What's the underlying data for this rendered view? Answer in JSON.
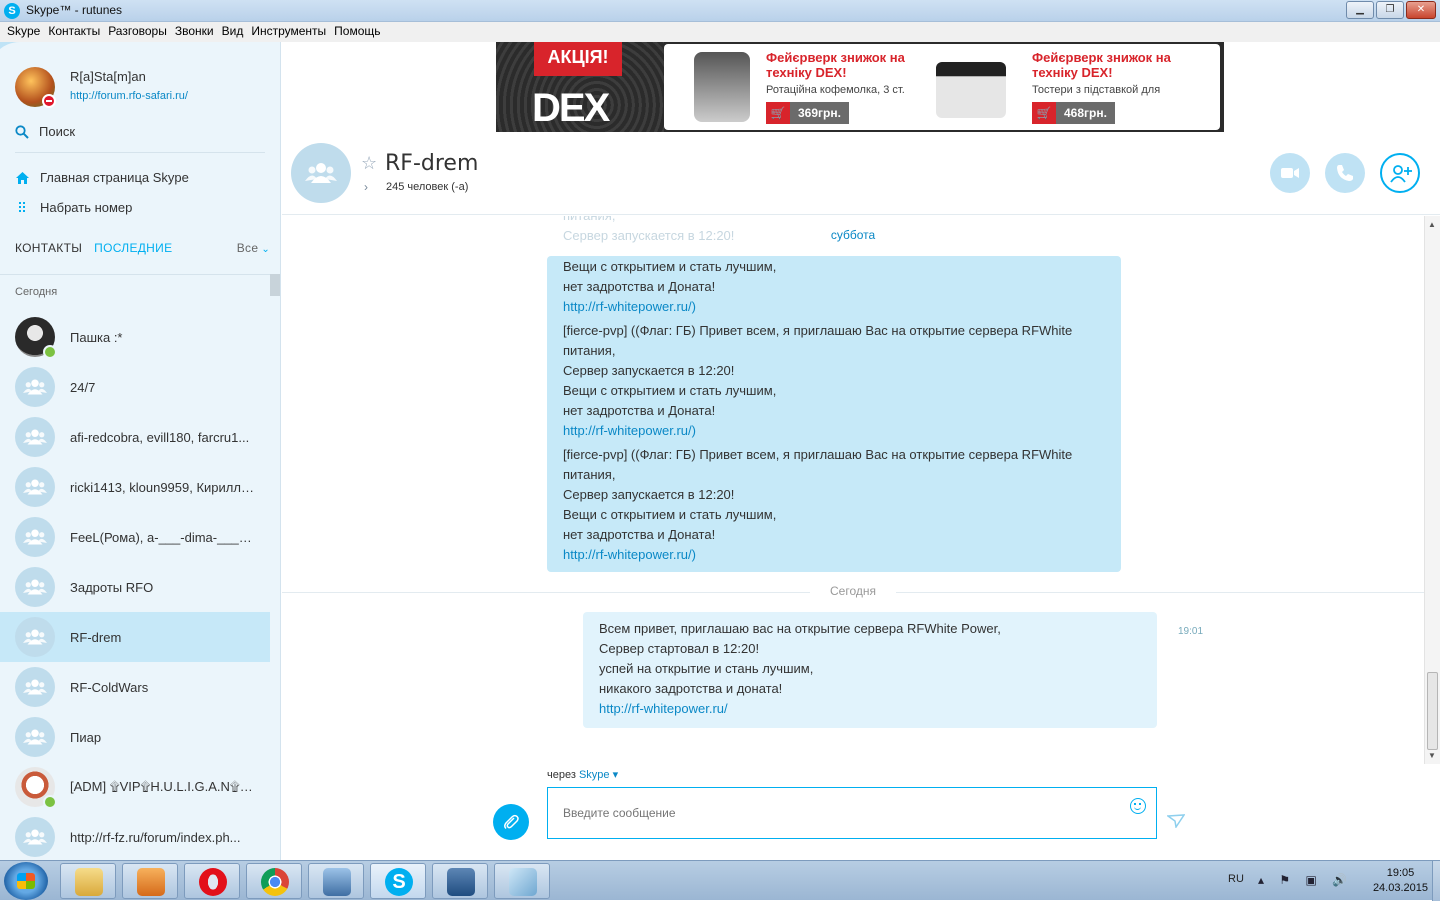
{
  "window": {
    "title": "Skype™ - rutunes"
  },
  "menu": [
    "Skype",
    "Контакты",
    "Разговоры",
    "Звонки",
    "Вид",
    "Инструменты",
    "Помощь"
  ],
  "profile": {
    "name": "R[a]Sta[m]an",
    "mood": "http://forum.rfo-safari.ru/",
    "status": "do-not-disturb"
  },
  "sidebar": {
    "search_label": "Поиск",
    "home_label": "Главная страница Skype",
    "dial_label": "Набрать номер",
    "tab_contacts": "КОНТАКТЫ",
    "tab_recent": "ПОСЛЕДНИЕ",
    "filter_label": "Все",
    "section_today": "Сегодня",
    "contacts": [
      {
        "name": "Пашка :*",
        "avatar": "photo",
        "online": true
      },
      {
        "name": "24/7",
        "avatar": "group"
      },
      {
        "name": "afi-redcobra, evill180, farcru1...",
        "avatar": "group"
      },
      {
        "name": "ricki1413, kloun9959, Кирилл, ...",
        "avatar": "group"
      },
      {
        "name": "FeeL(Рома), a-___-dima-___-a,...",
        "avatar": "group"
      },
      {
        "name": "Задроты RFO",
        "avatar": "group"
      },
      {
        "name": "RF-drem",
        "avatar": "group",
        "selected": true
      },
      {
        "name": "RF-ColdWars",
        "avatar": "group"
      },
      {
        "name": "Пиар",
        "avatar": "group"
      },
      {
        "name": "[ADM] ۩VIP۩H.U.L.I.G.A.N۩VIP۩",
        "avatar": "photo",
        "online": true
      },
      {
        "name": "http://rf-fz.ru/forum/index.ph...",
        "avatar": "group"
      }
    ]
  },
  "ad": {
    "badge": "АКЦІЯ!",
    "brand": "DEX",
    "products": [
      {
        "headline": "Фейєрверк знижок на техніку DEX!",
        "desc": "Ротаційна кофемолка, 3 ст.",
        "price": "369грн."
      },
      {
        "headline": "Фейєрверк знижок на техніку DEX!",
        "desc": "Тостери з підставкой для",
        "price": "468грн."
      }
    ]
  },
  "conversation": {
    "title": "RF-drem",
    "members": "245 человек (-а)",
    "faded_lines": [
      "питания,",
      "Сервер запускается в 12:20!"
    ],
    "day_label_old": "суббота",
    "old_message_lines": [
      {
        "text": "Вещи с открытием и стать лучшим,",
        "link": false
      },
      {
        "text": "нет задротства и Доната!",
        "link": false
      },
      {
        "text": "http://rf-whitepower.ru/)",
        "link": true
      },
      {
        "text": "[fierce-pvp] ((Флаг: ГБ) Привет всем, я приглашаю Вас на открытие сервера RFWhite",
        "link": false,
        "gap": true
      },
      {
        "text": "питания,",
        "link": false
      },
      {
        "text": "Сервер запускается в 12:20!",
        "link": false
      },
      {
        "text": "Вещи с открытием и стать лучшим,",
        "link": false
      },
      {
        "text": "нет задротства и Доната!",
        "link": false
      },
      {
        "text": "http://rf-whitepower.ru/)",
        "link": true
      },
      {
        "text": "[fierce-pvp] ((Флаг: ГБ) Привет всем, я приглашаю Вас на открытие сервера RFWhite",
        "link": false,
        "gap": true
      },
      {
        "text": "питания,",
        "link": false
      },
      {
        "text": "Сервер запускается в 12:20!",
        "link": false
      },
      {
        "text": "Вещи с открытием и стать лучшим,",
        "link": false
      },
      {
        "text": "нет задротства и Доната!",
        "link": false
      },
      {
        "text": "http://rf-whitepower.ru/)",
        "link": true
      }
    ],
    "day_label_today": "Сегодня",
    "new_message": {
      "time": "19:01",
      "lines": [
        {
          "text": "Всем привет, приглашаю вас на открытие сервера RFWhite Power,",
          "link": false
        },
        {
          "text": "Сервер стартовал в 12:20!",
          "link": false
        },
        {
          "text": "успей на открытие и стань лучшим,",
          "link": false
        },
        {
          "text": "никакого задротства и доната!",
          "link": false
        },
        {
          "text": "http://rf-whitepower.ru/",
          "link": true
        }
      ]
    }
  },
  "composer": {
    "via_prefix": "через",
    "via_service": "Skype",
    "placeholder": "Введите сообщение"
  },
  "taskbar": {
    "apps": [
      "explorer",
      "media-player",
      "opera",
      "chrome",
      "remote-desktop",
      "skype",
      "unknown-app",
      "notes"
    ],
    "language": "RU",
    "time": "19:05",
    "date": "24.03.2015"
  }
}
